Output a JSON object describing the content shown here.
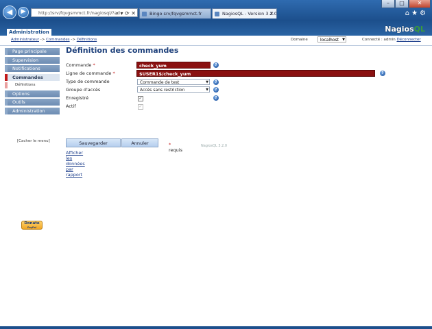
{
  "browser": {
    "address": "http://srv/fqvgsmmct.fr/nagiosql/?ad",
    "tabs": [
      {
        "label": "Bingo srv/fqvgsmmct.fr"
      },
      {
        "label": "NagiosQL - Version 3.2.0"
      }
    ],
    "window_buttons": {
      "minimize": "–",
      "maximize": "□",
      "close": "✕"
    }
  },
  "header": {
    "section_label": "Administration",
    "logo": {
      "part1": "Nagios",
      "part2": "QL"
    }
  },
  "subbar": {
    "breadcrumb": [
      "Administrateur",
      "Commandes",
      "Définitions"
    ],
    "breadcrumb_sep": "->",
    "domain_label": "Domaine",
    "domain_value": "localhost",
    "connected_text": "Connecté : admin",
    "logout_label": "Déconnecter"
  },
  "menu": {
    "items": [
      {
        "label": "Page principale"
      },
      {
        "label": "Supervision"
      },
      {
        "label": "Notifications"
      },
      {
        "label": "Commandes"
      },
      {
        "label": "Options"
      },
      {
        "label": "Outils"
      },
      {
        "label": "Administration"
      }
    ],
    "sub_item": "Définitions",
    "hide_label": "[Cacher le menu]"
  },
  "form": {
    "title": "Définition des commandes",
    "command_label": "Commande",
    "command_value": "check_yum",
    "cmdline_label": "Ligne de commande",
    "cmdline_value": "$USER1$/check_yum",
    "type_label": "Type de commande",
    "type_value": "Commande de test",
    "access_label": "Groupe d'accès",
    "access_value": "Accès sans restriction",
    "registered_label": "Enregistré",
    "active_label": "Actif",
    "required_mark": "*",
    "help_glyph": "?",
    "save_label": "Sauvegarder",
    "cancel_label": "Annuler",
    "required_note": "requis",
    "report_link": "Afficher les données par rapport",
    "version": "NagiosQL 3.2.0"
  },
  "donate": {
    "label": "Donate",
    "sub": "PayPal"
  }
}
